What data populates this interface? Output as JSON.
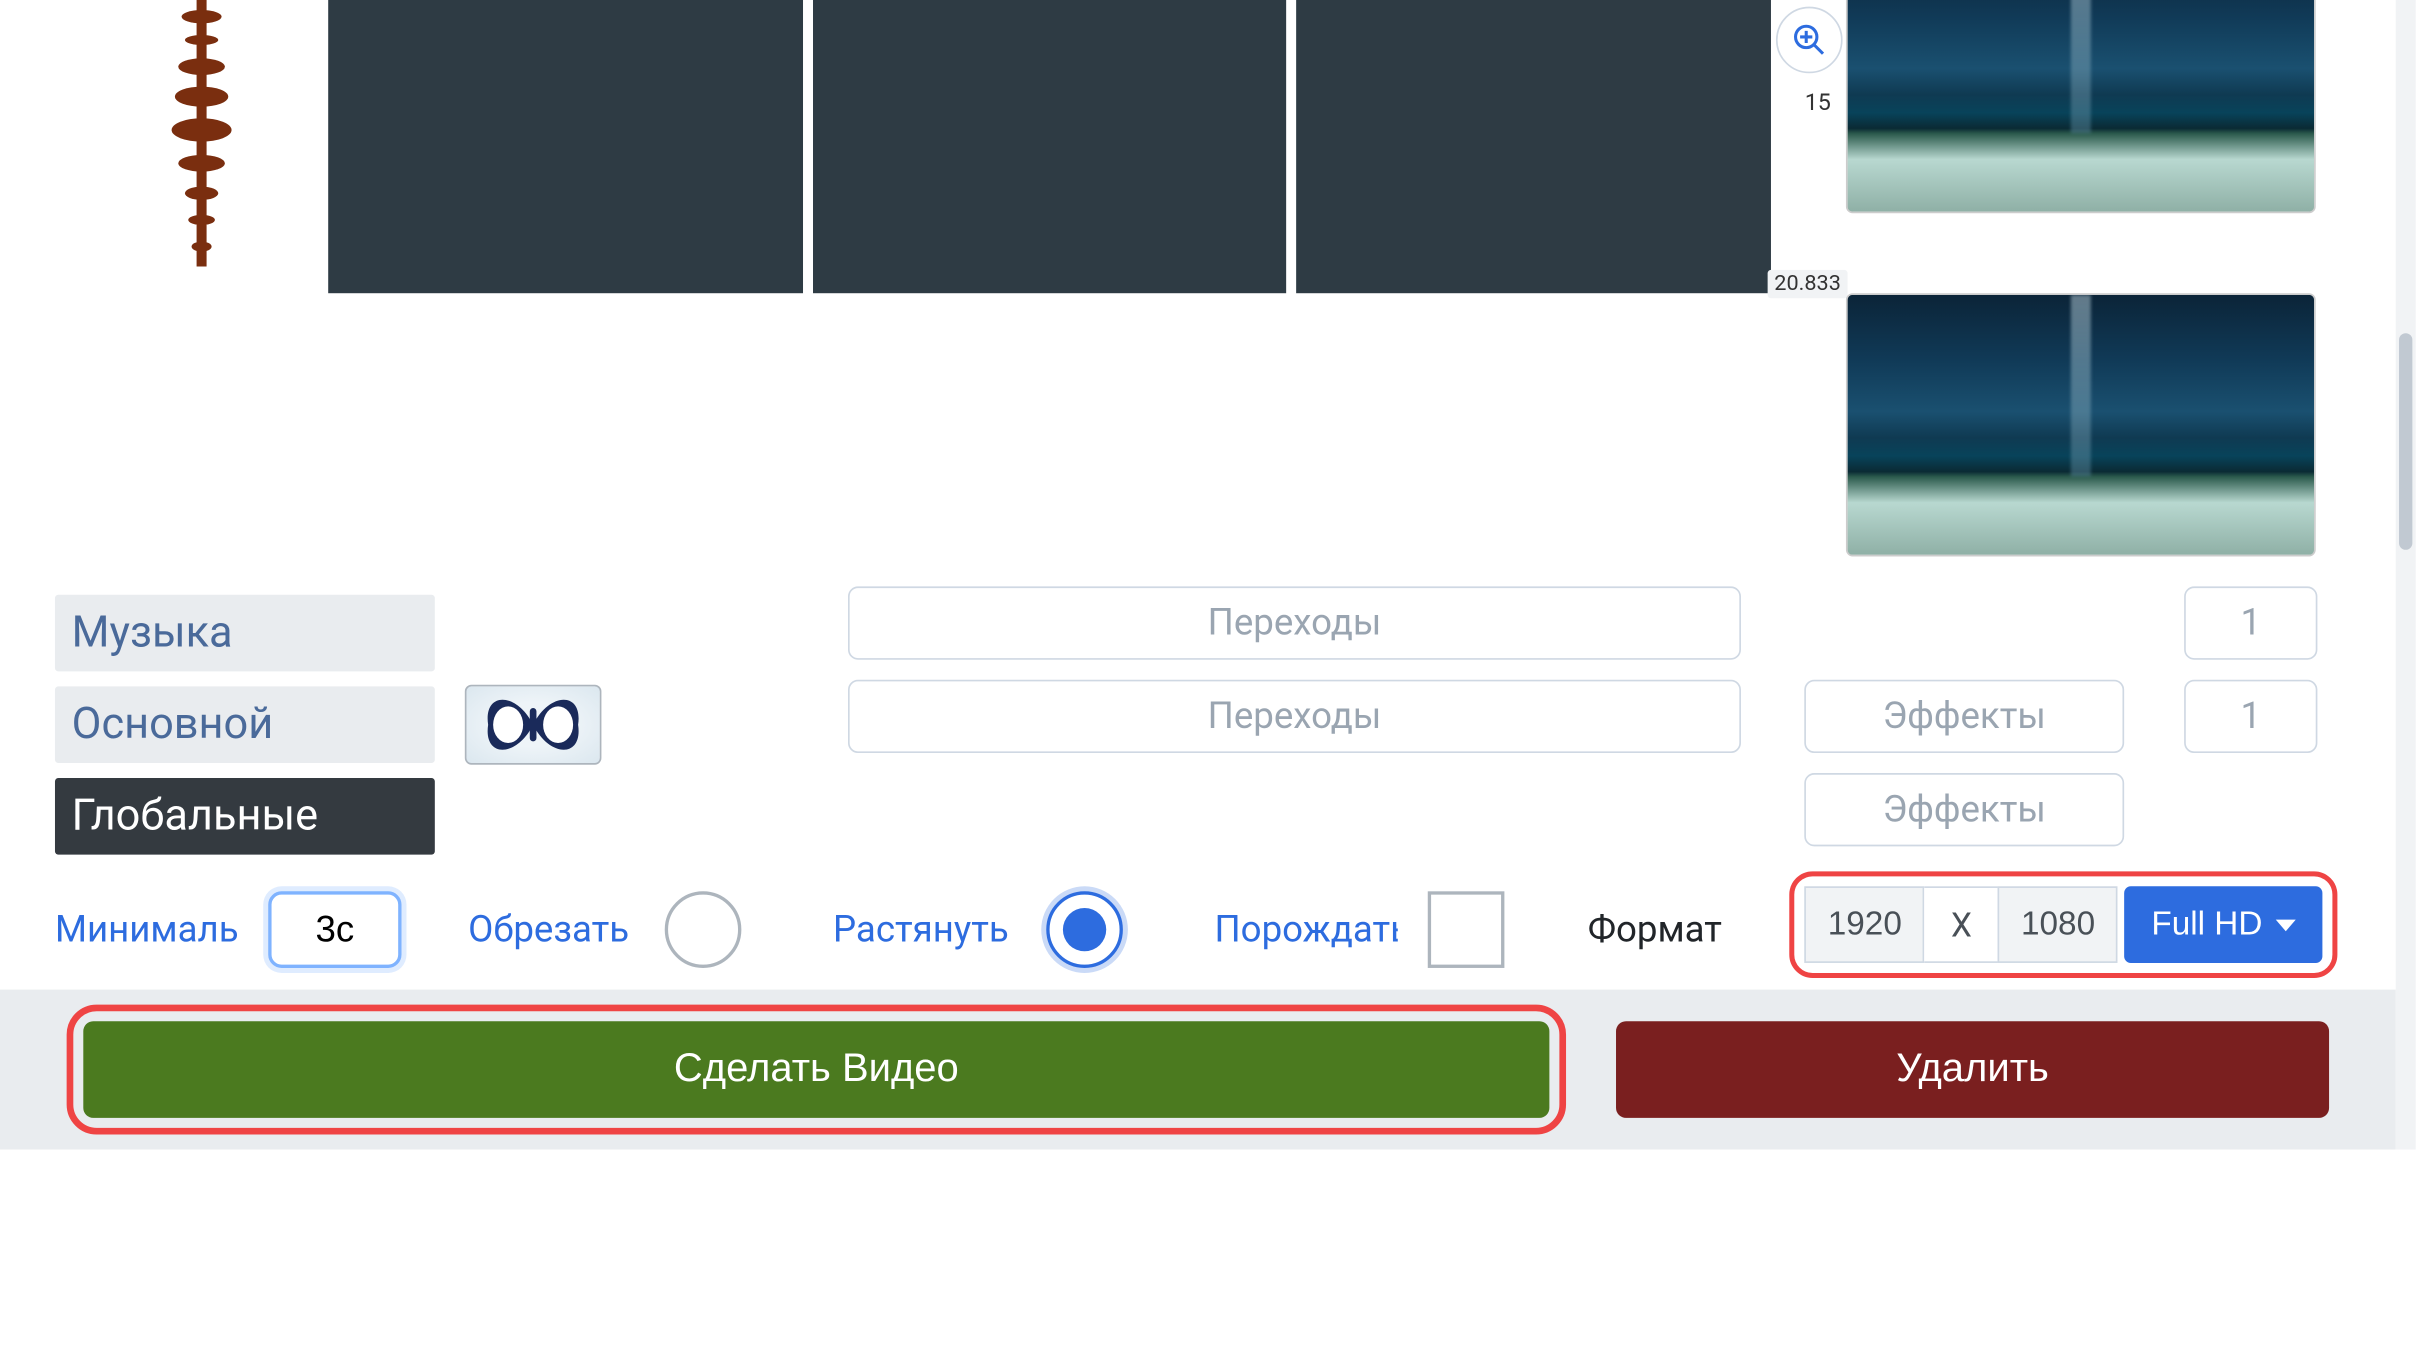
{
  "timeline": {
    "zoom_tick": "15",
    "thumb_timestamp_2": "20.833"
  },
  "tracks": {
    "music_label": "Музыка",
    "main_label": "Основной",
    "global_label": "Глобальные",
    "transitions_label": "Переходы",
    "effects_label": "Эффекты",
    "count_1": "1",
    "count_2": "1"
  },
  "options": {
    "min_label": "Минимальн",
    "min_value": "3с",
    "crop_label": "Обрезать",
    "stretch_label": "Растянуть",
    "spawn_label": "Порождать",
    "format_label": "Формат",
    "width": "1920",
    "height": "1080",
    "x_label": "X",
    "preset": "Full HD"
  },
  "actions": {
    "make_video": "Сделать Видео",
    "delete": "Удалить"
  }
}
